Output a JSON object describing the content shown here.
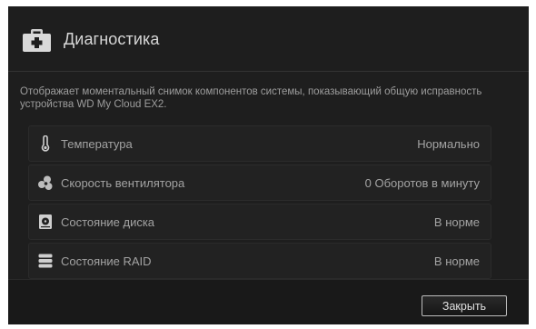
{
  "dialog": {
    "title": "Диагностика",
    "icon": "medical-kit-icon",
    "description": "Отображает моментальный снимок компонентов системы, показывающий общую исправность устройства WD My Cloud EX2."
  },
  "rows": [
    {
      "icon": "thermometer-icon",
      "label": "Температура",
      "value": "Нормально"
    },
    {
      "icon": "fan-icon",
      "label": "Скорость вентилятора",
      "value": "0 Оборотов в минуту"
    },
    {
      "icon": "disk-icon",
      "label": "Состояние диска",
      "value": "В норме"
    },
    {
      "icon": "raid-icon",
      "label": "Состояние RAID",
      "value": "В норме"
    }
  ],
  "footer": {
    "close_label": "Закрыть"
  },
  "colors": {
    "background": "#1e1e1e",
    "row_background": "#222222",
    "text": "#a3a3a3"
  }
}
